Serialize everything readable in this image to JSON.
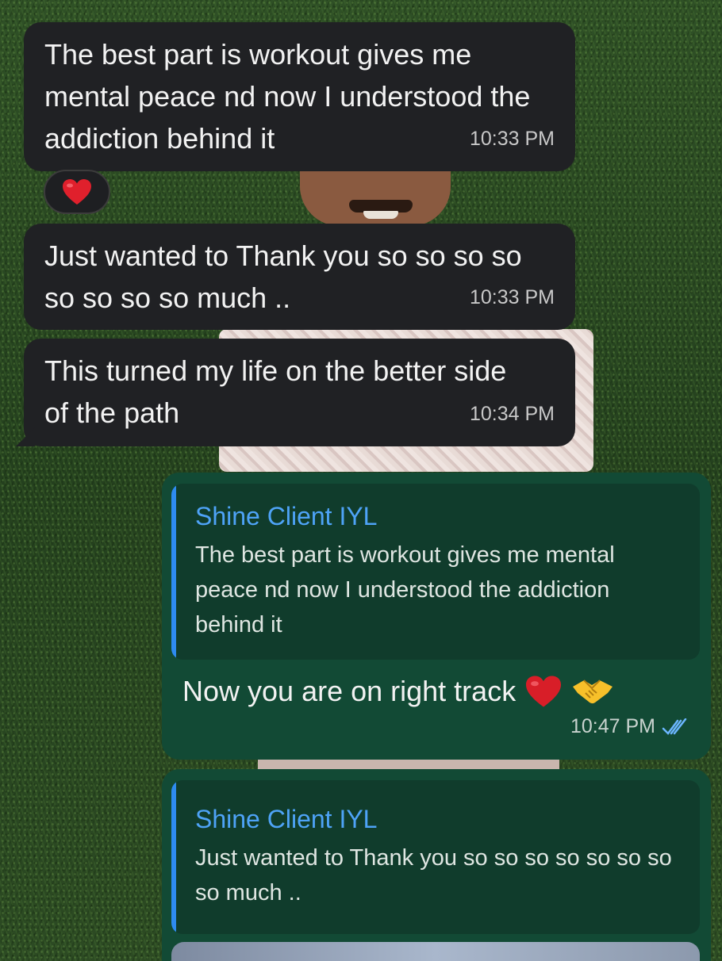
{
  "incoming": [
    {
      "text": "The best part is workout gives me mental peace nd now I understood the addiction behind it",
      "time": "10:33 PM",
      "reaction": "❤️"
    },
    {
      "text": "Just wanted to Thank you so so so so so so so so much ..",
      "time": "10:33 PM"
    },
    {
      "text": "This turned my life on the  better side of the path",
      "time": "10:34 PM"
    }
  ],
  "outgoing": [
    {
      "quote_author": "Shine Client IYL",
      "quote_text": "The best part is workout gives me mental peace nd now I understood the addiction behind it",
      "text": "Now you are on right track",
      "emojis": [
        "red-heart",
        "handshake"
      ],
      "time": "10:47 PM",
      "status": "read"
    },
    {
      "quote_author": "Shine Client IYL",
      "quote_text": "Just wanted to Thank you so so so so so so so so much .."
    }
  ],
  "colors": {
    "incoming_bubble": "#202124",
    "outgoing_bubble": "#124a35",
    "quote_bar": "#2e8bf0",
    "quote_author": "#4ea3f7",
    "read_ticks": "#6cb6ff"
  }
}
